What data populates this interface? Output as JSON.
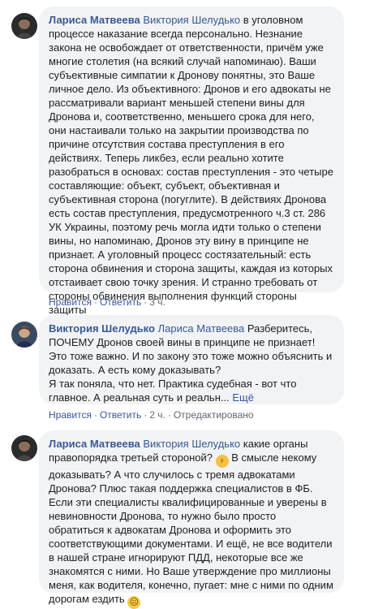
{
  "comments": [
    {
      "author": "Лариса Матвеева",
      "mention": "Виктория Шелудько",
      "text": "в уголовном процессе наказание всегда персонально. Незнание закона не освобождает от ответственности, причём уже многие столетия (на всякий случай напоминаю). Ваши субъективные симпатии к Дронову понятны, это Ваше личное дело. Из объективного: Дронов и его адвокаты не рассматривали вариант меньшей степени вины для Дронова и, соответственно, меньшего срока для него, они настаивали только на закрытии производства по причине отсутствия состава преступления в его действиях. Теперь ликбез, если реально хотите разобраться в основах: состав преступления - это четыре составляющие: объект, субъект, объективная и субъективная сторона (погуглите). В действиях Дронова есть состав преступления, предусмотренного ч.3 ст. 286 УК Украины, поэтому речь могла идти только о степени вины, но напоминаю, Дронов эту вину в принципе не признает. А уголовный процесс состязательный: есть сторона обвинения и сторона защиты, каждая из которых отстаивает свою точку зрения. И странно требовать от стороны обвинения выполнения функций стороны защиты",
      "like_label": "Нравится",
      "reply_label": "Ответить",
      "time": "3 ч."
    },
    {
      "author": "Виктория Шелудько",
      "mention": "Лариса Матвеева",
      "text": "Разберитесь, ПОЧЕМУ Дронов своей вины в принципе не признает! Это тоже важно. И по закону это тоже можно объяснить и доказать. А есть кому доказывать?",
      "text2": "Я так поняла, что нет. Практика судебная - вот что главное. А реальная суть и реальн...",
      "more_label": "Ещё",
      "like_label": "Нравится",
      "reply_label": "Ответить",
      "time": "2 ч.",
      "edited_label": "Отредактировано"
    },
    {
      "author": "Лариса Матвеева",
      "mention": "Виктория Шелудько",
      "text_a": "какие органы правопорядка третьей стороной?",
      "text_b": "В смысле некому доказывать? А что случилось с тремя адвокатами Дронова? Плюс такая поддержка специалистов в ФБ. Если эти специалисты квалифицированные и уверены в невиновности Дронова, то нужно было просто обратиться к адвокатам Дронова и оформить это соответствующими документами. И ещё, не все водители в нашей стране игнорируют ПДД, некоторые все же знакомятся с ними. Но Ваше утверждение про миллионы меня, как водителя, конечно, пугает: мне с ними по одним дорогам ездить",
      "emoji_1": "woman-shrugging-emoji",
      "emoji_2": "sad-face-emoji"
    }
  ],
  "colors": {
    "link": "#385898",
    "bubble": "#f2f3f5",
    "meta": "#606770",
    "text": "#1c1e21"
  }
}
